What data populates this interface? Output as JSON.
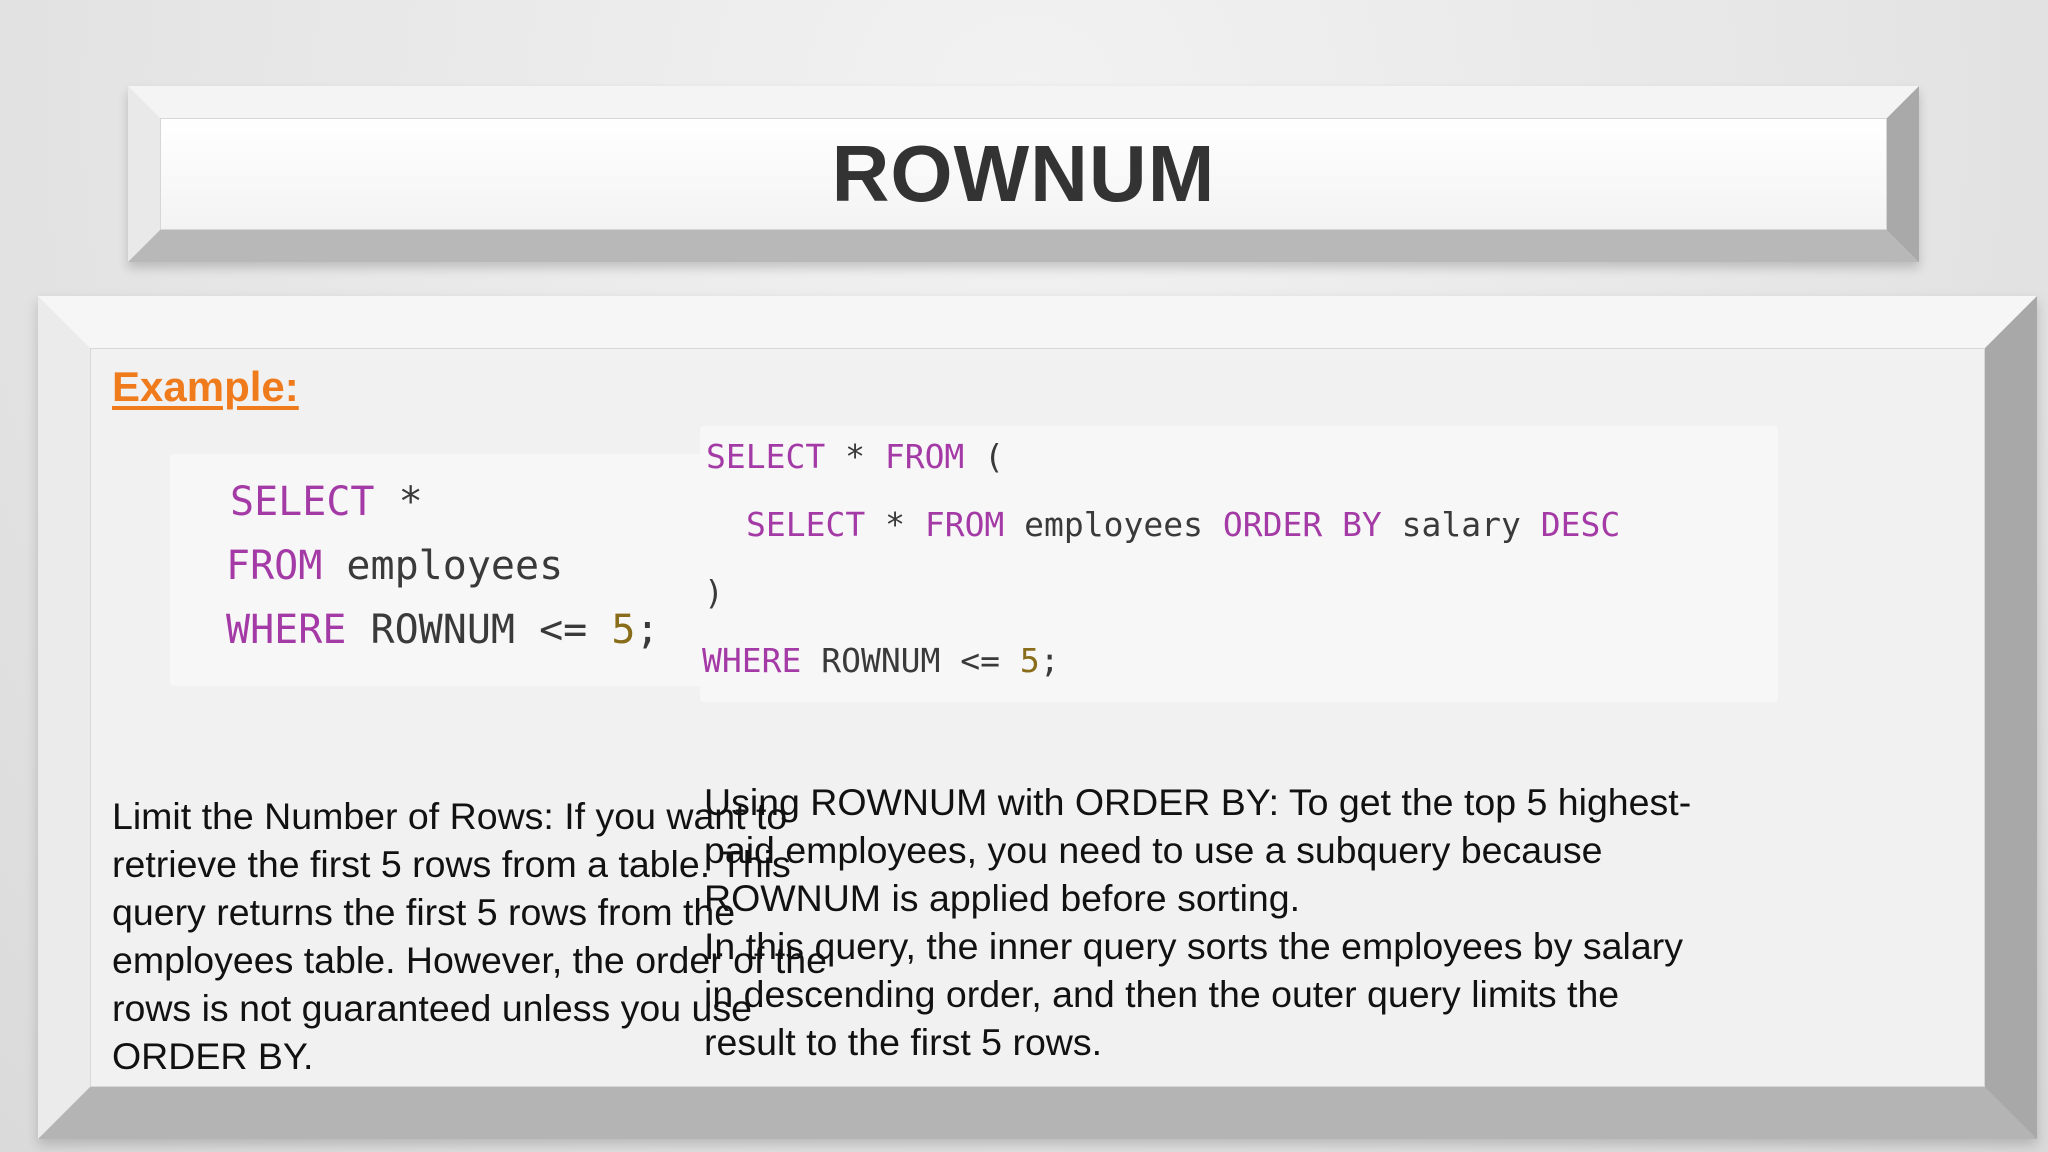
{
  "title": "ROWNUM",
  "example_label": "Example:",
  "left_code": {
    "line1": {
      "kw1": "SELECT",
      "rest": " *"
    },
    "line2": {
      "kw1": "FROM",
      "rest": " employees"
    },
    "line3": {
      "kw1": "WHERE",
      "rest": " ROWNUM <= ",
      "num": "5",
      "end": ";"
    }
  },
  "right_code": {
    "line1": {
      "kw1": "SELECT",
      "mid": " * ",
      "kw2": "FROM",
      "rest": " ("
    },
    "line2": {
      "kw1": "SELECT",
      "mid": " * ",
      "kw2": "FROM",
      "mid2": " employees ",
      "kw3": "ORDER BY",
      "mid3": " salary ",
      "kw4": "DESC"
    },
    "line3": {
      "text": ")"
    },
    "line4": {
      "kw1": "WHERE",
      "rest": " ROWNUM <= ",
      "num": "5",
      "end": ";"
    }
  },
  "left_description": "Limit the Number of Rows: If you want to retrieve the first 5 rows from a table. This query returns the first 5 rows from the employees table. However, the order of the rows is not guaranteed unless you use ORDER BY.",
  "right_description": {
    "paragraph1": "Using ROWNUM with ORDER BY: To get the top 5 highest-paid employees, you need to use a subquery because ROWNUM is applied before sorting.",
    "paragraph2": "In this query, the inner query sorts the employees by salary in descending order, and then the outer query limits the result to the first 5 rows."
  },
  "colors": {
    "keyword": "#a43aa6",
    "number": "#8a6d1b",
    "accent": "#f07b1d"
  }
}
